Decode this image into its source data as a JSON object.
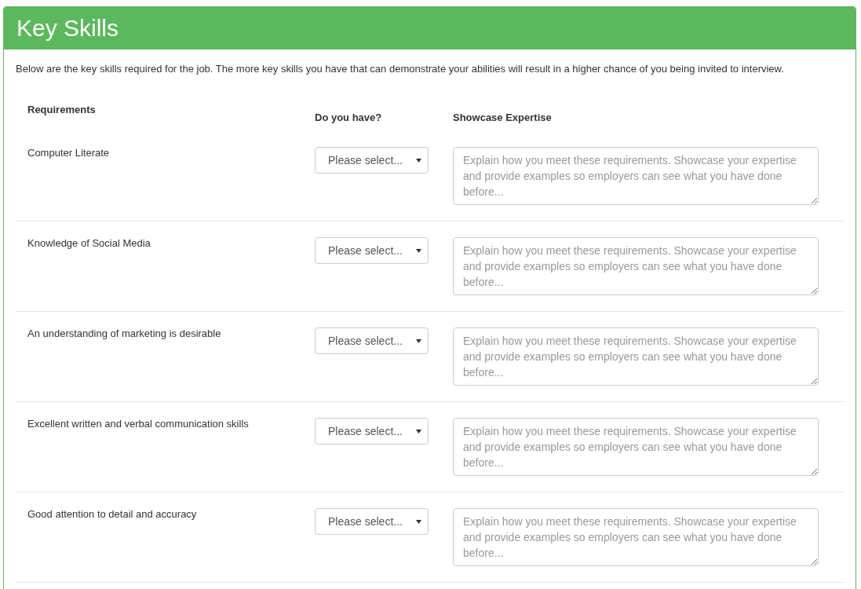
{
  "panel": {
    "title": "Key Skills",
    "intro": "Below are the key skills required for the job. The more key skills you have that can demonstrate your abilities will result in a higher chance of you being invited to interview."
  },
  "table": {
    "columns": [
      "Requirements",
      "Do you have?",
      "Showcase Expertise"
    ],
    "rows": [
      {
        "requirement": "Computer Literate",
        "select": "Please select...",
        "placeholder": "Explain how you meet these requirements. Showcase your expertise and provide examples so employers can see what you have done before..."
      },
      {
        "requirement": "Knowledge of Social Media",
        "select": "Please select...",
        "placeholder": "Explain how you meet these requirements. Showcase your expertise and provide examples so employers can see what you have done before..."
      },
      {
        "requirement": "An understanding of marketing is desirable",
        "select": "Please select...",
        "placeholder": "Explain how you meet these requirements. Showcase your expertise and provide examples so employers can see what you have done before..."
      },
      {
        "requirement": "Excellent written and verbal communication skills",
        "select": "Please select...",
        "placeholder": "Explain how you meet these requirements. Showcase your expertise and provide examples so employers can see what you have done before..."
      },
      {
        "requirement": "Good attention to detail and accuracy",
        "select": "Please select...",
        "placeholder": "Explain how you meet these requirements. Showcase your expertise and provide examples so employers can see what you have done before..."
      }
    ]
  }
}
